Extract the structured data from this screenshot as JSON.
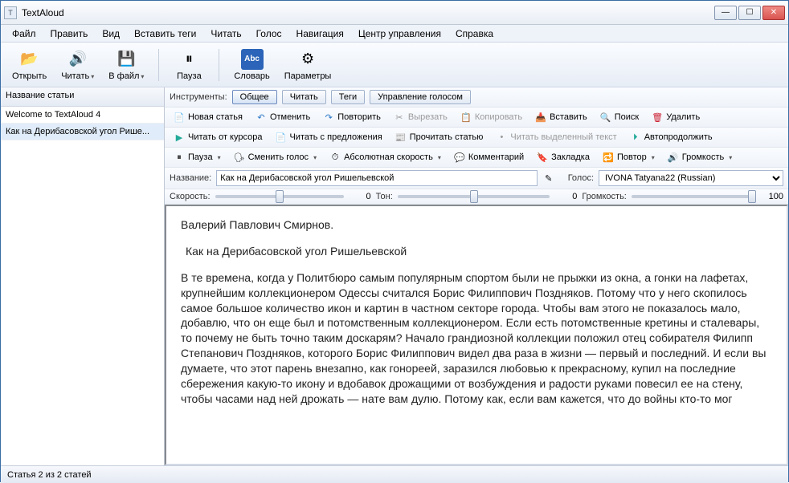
{
  "window": {
    "title": "TextAloud"
  },
  "menu": [
    "Файл",
    "Править",
    "Вид",
    "Вставить теги",
    "Читать",
    "Голос",
    "Навигация",
    "Центр управления",
    "Справка"
  ],
  "toolbar": [
    {
      "label": "Открыть",
      "icon": "📂"
    },
    {
      "label": "Читать",
      "icon": "🔊",
      "dd": true
    },
    {
      "label": "В файл",
      "icon": "💾",
      "dd": true
    },
    {
      "label": "Пауза",
      "icon": "⏸"
    },
    {
      "label": "Словарь",
      "icon": "Abc"
    },
    {
      "label": "Параметры",
      "icon": "⚙"
    }
  ],
  "sidebar": {
    "header": "Название статьи",
    "items": [
      "Welcome to TextAloud 4",
      "Как на Дерибасовской угол Рише..."
    ]
  },
  "tabs": {
    "label": "Инструменты:",
    "items": [
      "Общее",
      "Читать",
      "Теги",
      "Управление голосом"
    ],
    "active": 0
  },
  "row1": [
    {
      "icon": "📄",
      "label": "Новая статья"
    },
    {
      "icon": "↶",
      "label": "Отменить"
    },
    {
      "icon": "↷",
      "label": "Повторить"
    },
    {
      "icon": "✂",
      "label": "Вырезать",
      "disabled": true
    },
    {
      "icon": "📋",
      "label": "Копировать",
      "disabled": true
    },
    {
      "icon": "📥",
      "label": "Вставить"
    },
    {
      "icon": "🔍",
      "label": "Поиск"
    },
    {
      "icon": "🗑",
      "label": "Удалить"
    }
  ],
  "row2": [
    {
      "icon": "▶",
      "label": "Читать от курсора"
    },
    {
      "icon": "📄",
      "label": "Читать с предложения"
    },
    {
      "icon": "📰",
      "label": "Прочитать статью"
    },
    {
      "icon": "•",
      "label": "Читать выделенный текст",
      "disabled": true
    },
    {
      "icon": "⏵",
      "label": "Автопродолжить"
    }
  ],
  "row3": [
    {
      "icon": "⏸",
      "label": "Пауза",
      "dd": true
    },
    {
      "icon": "🗣",
      "label": "Сменить голос",
      "dd": true
    },
    {
      "icon": "⏱",
      "label": "Абсолютная скорость",
      "dd": true
    },
    {
      "icon": "💬",
      "label": "Комментарий"
    },
    {
      "icon": "🔖",
      "label": "Закладка"
    },
    {
      "icon": "🔁",
      "label": "Повтор",
      "dd": true
    },
    {
      "icon": "🔊",
      "label": "Громкость",
      "dd": true
    }
  ],
  "titleRow": {
    "nameLabel": "Название:",
    "nameValue": "Как на Дерибасовской угол Ришельевской",
    "voiceLabel": "Голос:",
    "voiceValue": "IVONA Tatyana22 (Russian)"
  },
  "sliders": {
    "speedLabel": "Скорость:",
    "speedValue": "0",
    "toneLabel": "Тон:",
    "toneValue": "0",
    "volLabel": "Громкость:",
    "volValue": "100"
  },
  "text": {
    "p1": "Валерий Павлович Смирнов.",
    "p2": "Как на Дерибасовской угол Ришельевской",
    "p3": "В те времена, когда у Политбюро самым популярным спортом были не прыжки из окна, а гонки на лафетах, крупнейшим коллекционером Одессы считался Борис Филиппович Поздняков. Потому что у него скопилось самое большое количество икон и картин в частном секторе города. Чтобы вам этого не показалось мало, добавлю, что он еще был и потомственным коллекционером. Если есть потомственные кретины и сталевары, то почему не быть точно таким доскарям? Начало грандиозной коллекции положил отец собирателя Филипп Степанович Поздняков, которого Борис Филиппович видел два раза в жизни — первый и последний. И если вы думаете, что этот парень внезапно, как гонореей, заразился любовью к прекрасному, купил на последние сбережения какую-то икону и вдобавок дрожащими от возбуждения и радости руками повесил ее на стену, чтобы часами над ней дрожать — нате вам дулю. Потому как, если вам кажется, что до войны кто-то мог"
  },
  "status": "Статья 2 из 2 статей"
}
